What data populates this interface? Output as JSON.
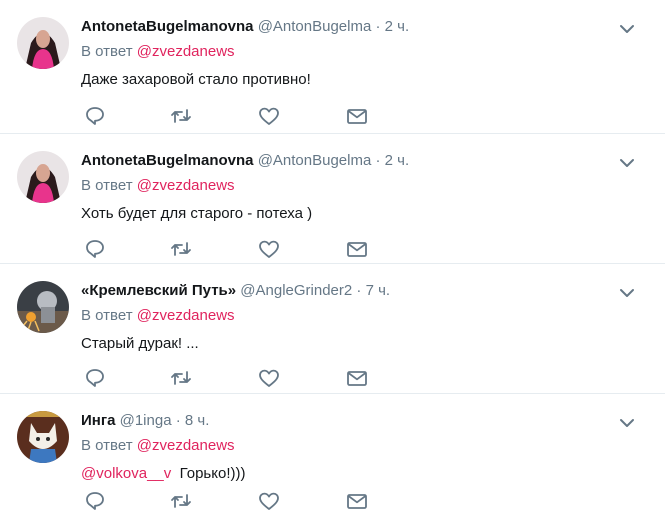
{
  "colors": {
    "mention": "#e0245e",
    "secondary_text": "#657786",
    "primary_text": "#14171a",
    "divider": "#e6ecf0",
    "icon": "#657786"
  },
  "icons": {
    "reply": "reply-icon",
    "retweet": "retweet-icon",
    "like": "heart-icon",
    "dm": "envelope-icon",
    "menu": "chevron-down-icon"
  },
  "tweets": [
    {
      "fullname": "AntonetaBugelmanovna",
      "username": "@AntonBugelma",
      "dot": "·",
      "time": "2 ч.",
      "reply_prefix": "В ответ",
      "reply_to": "@zvezdanews",
      "text": "Даже захаровой стало противно!"
    },
    {
      "fullname": "AntonetaBugelmanovna",
      "username": "@AntonBugelma",
      "dot": "·",
      "time": "2 ч.",
      "reply_prefix": "В ответ",
      "reply_to": "@zvezdanews",
      "text": "Хоть будет для старого - потеха )"
    },
    {
      "fullname": "«Кремлевский Путь»",
      "username": "@AngleGrinder2",
      "dot": "·",
      "time": "7 ч.",
      "reply_prefix": "В ответ",
      "reply_to": "@zvezdanews",
      "text": "Старый дурак! ..."
    },
    {
      "fullname": "Инга",
      "username": "@1inga",
      "dot": "·",
      "time": "8 ч.",
      "reply_prefix": "В ответ",
      "reply_to": "@zvezdanews",
      "text_mention": "@volkova__v",
      "text": "Горько!)))"
    }
  ]
}
